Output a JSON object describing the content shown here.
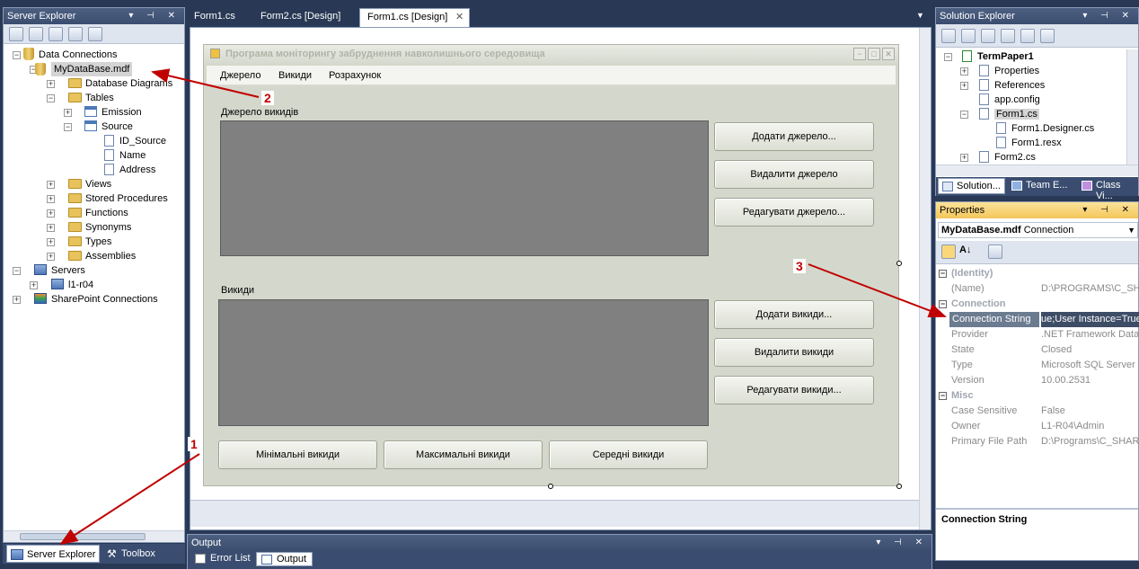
{
  "server_explorer": {
    "title": "Server Explorer",
    "tree": [
      {
        "label": "Data Connections"
      },
      {
        "label": "MyDataBase.mdf"
      },
      {
        "label": "Database Diagrams"
      },
      {
        "label": "Tables"
      },
      {
        "label": "Emission"
      },
      {
        "label": "Source"
      },
      {
        "label": "ID_Source"
      },
      {
        "label": "Name"
      },
      {
        "label": "Address"
      },
      {
        "label": "Views"
      },
      {
        "label": "Stored Procedures"
      },
      {
        "label": "Functions"
      },
      {
        "label": "Synonyms"
      },
      {
        "label": "Types"
      },
      {
        "label": "Assemblies"
      },
      {
        "label": "Servers"
      },
      {
        "label": "l1-r04"
      },
      {
        "label": "SharePoint Connections"
      }
    ],
    "bottom_tabs": [
      "Server Explorer",
      "Toolbox"
    ]
  },
  "doc_tabs": [
    "Form1.cs",
    "Form2.cs [Design]",
    "Form1.cs [Design]"
  ],
  "form": {
    "title": "Програма моніторингу забруднення навколишнього середовища",
    "menu": [
      "Джерело",
      "Викиди",
      "Розрахунок"
    ],
    "source_label": "Джерело викидів",
    "emissions_label": "Викиди",
    "buttons_source": [
      "Додати джерело...",
      "Видалити джерело",
      "Редагувати джерело..."
    ],
    "buttons_emissions": [
      "Додати викиди...",
      "Видалити викиди",
      "Редагувати викиди..."
    ],
    "buttons_bottom": [
      "Мінімальні викиди",
      "Максимальні викиди",
      "Середні викиди"
    ]
  },
  "output": {
    "title": "Output",
    "tabs": [
      "Error List",
      "Output"
    ]
  },
  "solution_explorer": {
    "title": "Solution Explorer",
    "tree": [
      {
        "label": "TermPaper1"
      },
      {
        "label": "Properties"
      },
      {
        "label": "References"
      },
      {
        "label": "app.config"
      },
      {
        "label": "Form1.cs"
      },
      {
        "label": "Form1.Designer.cs"
      },
      {
        "label": "Form1.resx"
      },
      {
        "label": "Form2.cs"
      }
    ],
    "bottom_tabs": [
      "Solution...",
      "Team E...",
      "Class Vi..."
    ]
  },
  "properties": {
    "title": "Properties",
    "object_name": "MyDataBase.mdf",
    "object_type": "Connection",
    "categories": [
      {
        "name": "(Identity)",
        "rows": [
          {
            "key": "(Name)",
            "value": "D:\\PROGRAMS\\C_SHARP"
          }
        ]
      },
      {
        "name": "Connection",
        "rows": [
          {
            "key": "Connection String",
            "value": "ue;User Instance=True"
          },
          {
            "key": "Provider",
            "value": ".NET Framework Data"
          },
          {
            "key": "State",
            "value": "Closed"
          },
          {
            "key": "Type",
            "value": "Microsoft SQL Server"
          },
          {
            "key": "Version",
            "value": "10.00.2531"
          }
        ]
      },
      {
        "name": "Misc",
        "rows": [
          {
            "key": "Case Sensitive",
            "value": "False"
          },
          {
            "key": "Owner",
            "value": "L1-R04\\Admin"
          },
          {
            "key": "Primary File Path",
            "value": "D:\\Programs\\C_SHARP"
          }
        ]
      }
    ],
    "description_title": "Connection String"
  },
  "annotations": [
    "1",
    "2",
    "3"
  ],
  "colors": {
    "annotation": "#c00000",
    "selection": "#316ac5",
    "titlebar": "#3a4d70"
  }
}
